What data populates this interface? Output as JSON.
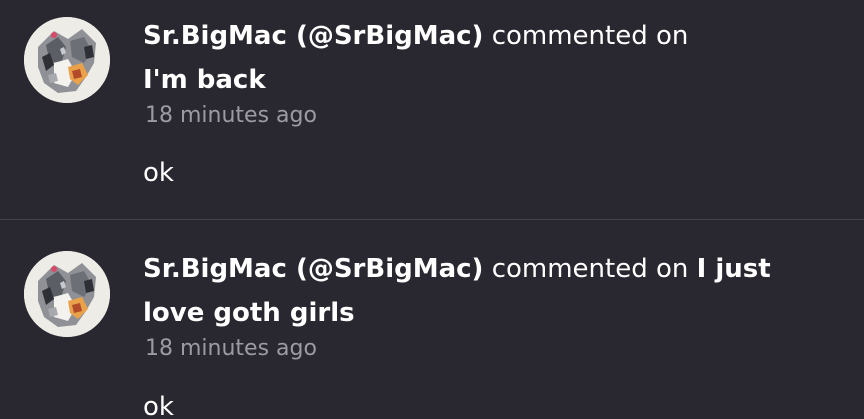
{
  "comments": [
    {
      "user": "Sr.BigMac (@SrBigMac)",
      "verb": "commented on",
      "post_title": "I'm back",
      "time": "18 minutes ago",
      "text": "ok",
      "avatar_icon": "avatar-image"
    },
    {
      "user": "Sr.BigMac (@SrBigMac)",
      "verb": "commented on",
      "post_title": "I just love goth girls",
      "time": "18 minutes ago",
      "text": "ok",
      "avatar_icon": "avatar-image"
    }
  ],
  "colors": {
    "background": "#29272f",
    "divider": "#44424b",
    "muted_text": "#9c9aa3",
    "primary_text": "#ffffff"
  }
}
